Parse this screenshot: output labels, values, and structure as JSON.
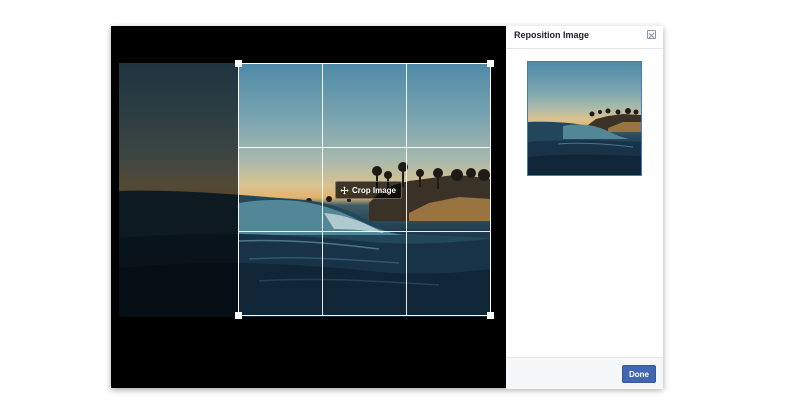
{
  "dialog": {
    "title": "Reposition Image",
    "done_label": "Done"
  },
  "crop": {
    "label": "Crop Image",
    "icon": "move-arrows-icon"
  },
  "icons": {
    "close": "close-icon",
    "move": "move-arrows-icon"
  },
  "colors": {
    "accent": "#4267b2",
    "stage_bg": "#000000",
    "thumb_border": "#4a76c2"
  }
}
